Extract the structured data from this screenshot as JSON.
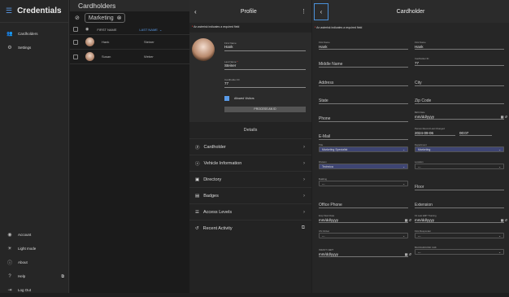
{
  "app": {
    "title": "Credentials",
    "menu_icon": "menu-icon"
  },
  "sidebar": {
    "items": [
      {
        "label": "Cardholders",
        "icon": "users-icon"
      },
      {
        "label": "Settings",
        "icon": "gear-icon"
      }
    ],
    "bottom": [
      {
        "label": "Account",
        "icon": "account-icon"
      },
      {
        "label": "Light mode",
        "icon": "sun-icon"
      },
      {
        "label": "About",
        "icon": "info-icon"
      },
      {
        "label": "Help",
        "icon": "help-icon"
      },
      {
        "label": "Log Out",
        "icon": "logout-icon"
      }
    ]
  },
  "list": {
    "title": "Cardholders",
    "filter_chip": "Marketing",
    "columns": [
      "FIRST NAME",
      "LAST NAME"
    ],
    "rows": [
      {
        "first": "Hank",
        "last": "Steiner"
      },
      {
        "first": "Susan",
        "last": "Weber"
      }
    ]
  },
  "profile": {
    "title": "Profile",
    "required_note": "An asterisk indicates a required field",
    "first_name_label": "First Name",
    "first_name": "Hank",
    "last_name_label": "Last Name",
    "last_name": "Steiner",
    "cardholder_id_label": "Cardholder ID",
    "cardholder_id": "77",
    "allowed_visitors": "Allowed Visitors",
    "process_button": "PROCESS AN ID",
    "details_heading": "Details",
    "sections": [
      "Cardholder",
      "Vehicle Information",
      "Directory",
      "Badges",
      "Access Levels",
      "Recent Activity"
    ]
  },
  "cardholder": {
    "title": "Cardholder",
    "required_note": "An asterisk indicates a required field",
    "first_name_label": "First Name",
    "first_name": "Hank",
    "last_name_label": "Last Name",
    "last_name": "Steiner",
    "cardholder_id_label": "Cardholder ID",
    "cardholder_id": "77",
    "middle_name": "Middle Name",
    "address": "Address",
    "city": "City",
    "state": "State",
    "zip": "Zip Code",
    "phone": "Phone",
    "birth_date_label": "Birth Date",
    "birth_date": "mm/dd/yyyy",
    "email": "E-Mail",
    "person_changed_label": "Person Record Last Changed",
    "person_changed_date": "2024-09-06",
    "person_changed_time": "00:07",
    "title_label": "Title",
    "title_value": "Marketing Specialist",
    "department_label": "Department",
    "department_value": "Marketing",
    "division_label": "Division",
    "division_value": "Technica",
    "location_label": "Location",
    "location_value": "---",
    "building_label": "Building",
    "building_value": "---",
    "floor": "Floor",
    "office_phone": "Office Phone",
    "extension": "Extension",
    "emp_start_label": "Emp Start Date",
    "emp_start": "mm/dd/yyyy",
    "fit_training_label": "Fit Last EMT Training",
    "fit_training": "mm/dd/yyyy",
    "us_citizen_label": "US Citizen",
    "us_citizen": "---",
    "first_responder_label": "First Responder",
    "first_responder": "---",
    "infant_label": "INFANT CERT",
    "infant": "mm/dd/yyyy",
    "background_label": "BACKGROUND CHK",
    "background": "---"
  }
}
